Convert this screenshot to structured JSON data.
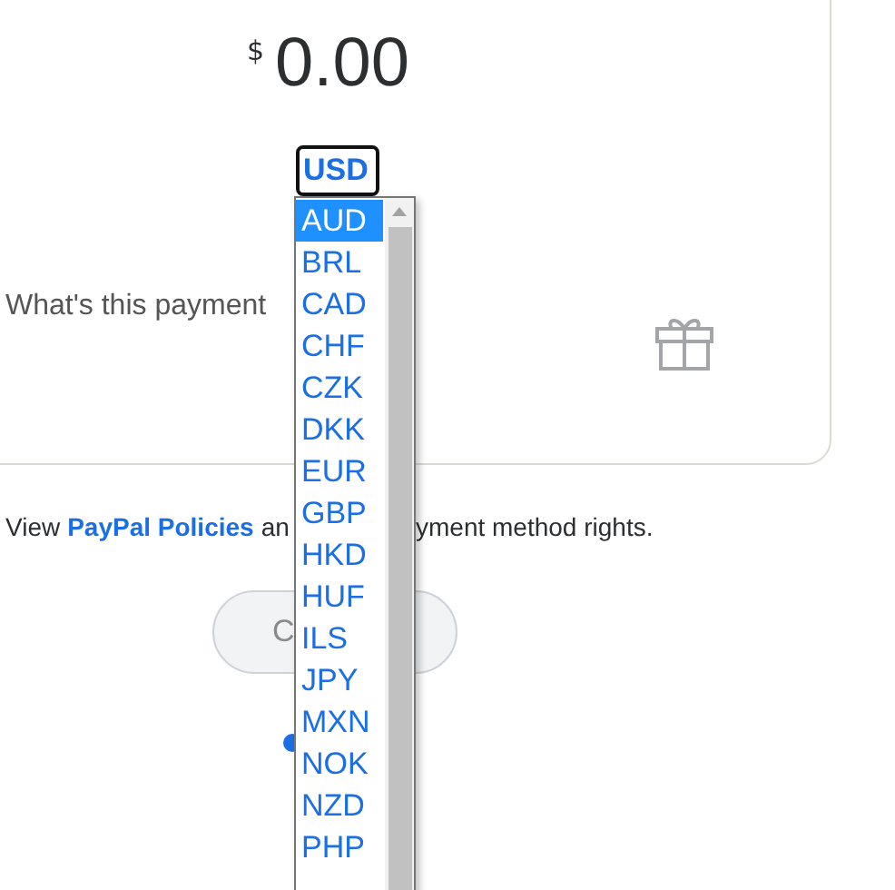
{
  "amount": {
    "currency_symbol": "$",
    "value": "0.00"
  },
  "currency_select": {
    "value": "USD",
    "options": [
      {
        "label": "AUD",
        "selected": true
      },
      {
        "label": "BRL",
        "selected": false
      },
      {
        "label": "CAD",
        "selected": false
      },
      {
        "label": "CHF",
        "selected": false
      },
      {
        "label": "CZK",
        "selected": false
      },
      {
        "label": "DKK",
        "selected": false
      },
      {
        "label": "EUR",
        "selected": false
      },
      {
        "label": "GBP",
        "selected": false
      },
      {
        "label": "HKD",
        "selected": false
      },
      {
        "label": "HUF",
        "selected": false
      },
      {
        "label": "ILS",
        "selected": false
      },
      {
        "label": "JPY",
        "selected": false
      },
      {
        "label": "MXN",
        "selected": false
      },
      {
        "label": "NOK",
        "selected": false
      },
      {
        "label": "NZD",
        "selected": false
      },
      {
        "label": "PHP",
        "selected": false
      }
    ]
  },
  "payment_type": {
    "question": "What's this payment"
  },
  "policy_line": {
    "before": [
      {
        "kind": "text",
        "text": "View"
      },
      {
        "kind": "link",
        "text": "PayPal Policies"
      },
      {
        "kind": "text",
        "text": "an"
      }
    ],
    "after": "yment method rights."
  },
  "button": {
    "label": "C",
    "disabled": true
  }
}
